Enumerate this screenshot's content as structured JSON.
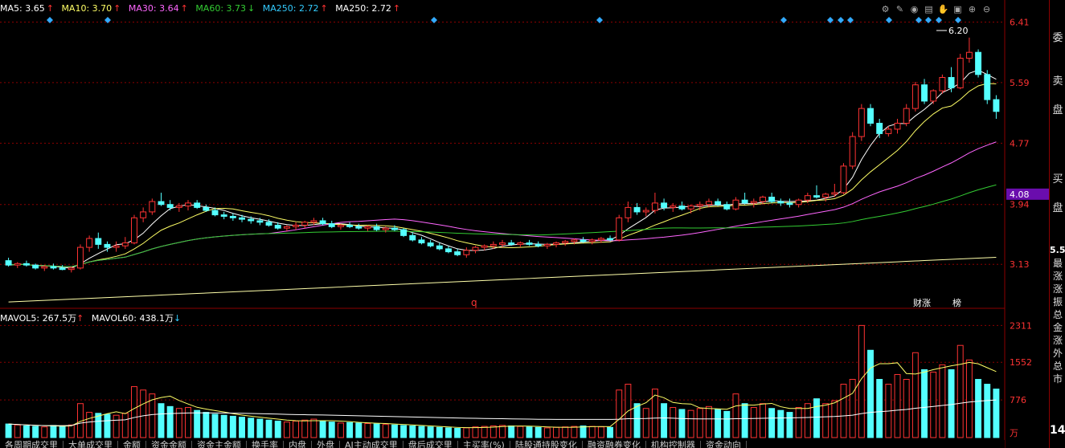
{
  "ma_legend": {
    "ma5": {
      "label": "MA5: 3.65",
      "color": "#ffffff"
    },
    "ma10": {
      "label": "MA10: 3.70",
      "color": "#ffff66"
    },
    "ma30": {
      "label": "MA30: 3.64",
      "color": "#ff66ff"
    },
    "ma60": {
      "label": "MA60: 3.73",
      "color": "#33cc33"
    },
    "ma250a": {
      "label": "MA250: 2.72",
      "color": "#33ccff"
    },
    "ma250b": {
      "label": "MA250: 2.72",
      "color": "#ffffff"
    },
    "up_arrow": "↑",
    "down_arrow": "↓"
  },
  "vol_legend": {
    "mavol5": "MAVOL5: 267.5万",
    "mavol60": "MAVOL60: 438.1万"
  },
  "price_axis": [
    "6.41",
    "5.59",
    "4.77",
    "3.94",
    "3.13"
  ],
  "current_price_tag": "4.08",
  "high_label": "6.20",
  "volume_axis": [
    "2311",
    "1552",
    "776"
  ],
  "volume_unit": "万",
  "markers": {
    "q_label": "q",
    "caizhang": "财涨",
    "bang": "榜"
  },
  "right_panel": {
    "wei": "委",
    "mai_sell": "卖",
    "pan1": "盘",
    "mai_buy": "买",
    "pan2": "盘",
    "num1": "5.5",
    "col_text": "最涨涨振总金涨外总市",
    "num2": "14"
  },
  "toolbar_icons": [
    "gear-icon",
    "pencil-icon",
    "eye-icon",
    "print-icon",
    "hand-icon",
    "lock-icon",
    "zoom-in-icon",
    "zoom-out-icon"
  ],
  "bottom_tabs": [
    "各周期成交里",
    "大单成交里",
    "金额",
    "资金金额",
    "资金主金额",
    "换手率",
    "内盘",
    "外盘",
    "AI主动成交里",
    "盘后成交里",
    "主买率(%)",
    "陆股通持股变化",
    "融资融券变化",
    "机构控制器",
    "资金动向"
  ],
  "chart_data": {
    "type": "candlestick",
    "ylim": [
      2.6,
      6.6
    ],
    "volume_ylim": [
      0,
      2400
    ],
    "candles": [
      [
        3.18,
        3.22,
        3.1,
        3.12
      ],
      [
        3.12,
        3.16,
        3.08,
        3.14
      ],
      [
        3.14,
        3.18,
        3.1,
        3.12
      ],
      [
        3.12,
        3.14,
        3.06,
        3.08
      ],
      [
        3.08,
        3.12,
        3.04,
        3.1
      ],
      [
        3.1,
        3.14,
        3.06,
        3.08
      ],
      [
        3.08,
        3.12,
        3.05,
        3.06
      ],
      [
        3.06,
        3.1,
        3.02,
        3.08
      ],
      [
        3.08,
        3.4,
        3.06,
        3.36
      ],
      [
        3.36,
        3.52,
        3.3,
        3.48
      ],
      [
        3.48,
        3.56,
        3.34,
        3.4
      ],
      [
        3.4,
        3.44,
        3.3,
        3.36
      ],
      [
        3.36,
        3.44,
        3.3,
        3.38
      ],
      [
        3.38,
        3.5,
        3.34,
        3.42
      ],
      [
        3.42,
        3.8,
        3.4,
        3.76
      ],
      [
        3.76,
        3.9,
        3.7,
        3.84
      ],
      [
        3.84,
        4.02,
        3.8,
        3.98
      ],
      [
        3.98,
        4.1,
        3.92,
        3.94
      ],
      [
        3.94,
        4.0,
        3.86,
        3.9
      ],
      [
        3.9,
        3.96,
        3.84,
        3.92
      ],
      [
        3.92,
        4.0,
        3.86,
        3.96
      ],
      [
        3.96,
        4.0,
        3.88,
        3.9
      ],
      [
        3.9,
        3.94,
        3.84,
        3.86
      ],
      [
        3.86,
        3.9,
        3.78,
        3.8
      ],
      [
        3.8,
        3.84,
        3.74,
        3.78
      ],
      [
        3.78,
        3.82,
        3.72,
        3.76
      ],
      [
        3.76,
        3.8,
        3.7,
        3.74
      ],
      [
        3.74,
        3.78,
        3.68,
        3.72
      ],
      [
        3.72,
        3.76,
        3.66,
        3.7
      ],
      [
        3.7,
        3.74,
        3.64,
        3.66
      ],
      [
        3.66,
        3.7,
        3.6,
        3.62
      ],
      [
        3.62,
        3.66,
        3.58,
        3.64
      ],
      [
        3.64,
        3.7,
        3.6,
        3.66
      ],
      [
        3.66,
        3.72,
        3.62,
        3.7
      ],
      [
        3.7,
        3.76,
        3.66,
        3.72
      ],
      [
        3.72,
        3.76,
        3.66,
        3.68
      ],
      [
        3.68,
        3.72,
        3.62,
        3.64
      ],
      [
        3.64,
        3.68,
        3.6,
        3.66
      ],
      [
        3.66,
        3.7,
        3.62,
        3.64
      ],
      [
        3.64,
        3.68,
        3.6,
        3.62
      ],
      [
        3.62,
        3.66,
        3.58,
        3.64
      ],
      [
        3.64,
        3.68,
        3.58,
        3.6
      ],
      [
        3.6,
        3.64,
        3.56,
        3.62
      ],
      [
        3.62,
        3.66,
        3.58,
        3.6
      ],
      [
        3.6,
        3.62,
        3.5,
        3.52
      ],
      [
        3.52,
        3.56,
        3.44,
        3.46
      ],
      [
        3.46,
        3.5,
        3.4,
        3.42
      ],
      [
        3.42,
        3.46,
        3.36,
        3.38
      ],
      [
        3.38,
        3.42,
        3.32,
        3.34
      ],
      [
        3.34,
        3.38,
        3.28,
        3.3
      ],
      [
        3.3,
        3.34,
        3.24,
        3.26
      ],
      [
        3.26,
        3.36,
        3.22,
        3.32
      ],
      [
        3.32,
        3.38,
        3.28,
        3.36
      ],
      [
        3.36,
        3.4,
        3.32,
        3.38
      ],
      [
        3.38,
        3.44,
        3.34,
        3.4
      ],
      [
        3.4,
        3.46,
        3.36,
        3.42
      ],
      [
        3.42,
        3.46,
        3.38,
        3.4
      ],
      [
        3.4,
        3.44,
        3.36,
        3.42
      ],
      [
        3.42,
        3.46,
        3.38,
        3.4
      ],
      [
        3.4,
        3.44,
        3.36,
        3.38
      ],
      [
        3.38,
        3.42,
        3.34,
        3.4
      ],
      [
        3.4,
        3.44,
        3.36,
        3.42
      ],
      [
        3.42,
        3.46,
        3.38,
        3.44
      ],
      [
        3.44,
        3.48,
        3.4,
        3.46
      ],
      [
        3.46,
        3.5,
        3.42,
        3.44
      ],
      [
        3.44,
        3.48,
        3.4,
        3.46
      ],
      [
        3.46,
        3.5,
        3.42,
        3.48
      ],
      [
        3.48,
        3.52,
        3.44,
        3.46
      ],
      [
        3.46,
        3.8,
        3.44,
        3.76
      ],
      [
        3.76,
        3.98,
        3.7,
        3.9
      ],
      [
        3.9,
        3.96,
        3.8,
        3.84
      ],
      [
        3.84,
        3.9,
        3.78,
        3.86
      ],
      [
        3.86,
        4.1,
        3.82,
        3.96
      ],
      [
        3.96,
        4.02,
        3.86,
        3.9
      ],
      [
        3.9,
        3.96,
        3.84,
        3.92
      ],
      [
        3.92,
        3.98,
        3.86,
        3.88
      ],
      [
        3.88,
        3.94,
        3.82,
        3.92
      ],
      [
        3.92,
        3.98,
        3.86,
        3.94
      ],
      [
        3.94,
        4.02,
        3.9,
        3.98
      ],
      [
        3.98,
        4.02,
        3.92,
        3.94
      ],
      [
        3.94,
        3.98,
        3.86,
        3.88
      ],
      [
        3.88,
        4.04,
        3.86,
        4.0
      ],
      [
        4.0,
        4.1,
        3.94,
        3.96
      ],
      [
        3.96,
        4.02,
        3.9,
        3.98
      ],
      [
        3.98,
        4.06,
        3.94,
        4.04
      ],
      [
        4.04,
        4.1,
        3.96,
        3.98
      ],
      [
        3.98,
        4.02,
        3.92,
        3.96
      ],
      [
        3.96,
        4.02,
        3.9,
        3.94
      ],
      [
        3.94,
        4.02,
        3.9,
        4.0
      ],
      [
        4.0,
        4.1,
        3.96,
        4.06
      ],
      [
        4.06,
        4.2,
        4.02,
        4.04
      ],
      [
        4.04,
        4.1,
        3.98,
        4.08
      ],
      [
        4.08,
        4.22,
        4.04,
        4.1
      ],
      [
        4.1,
        4.5,
        4.08,
        4.46
      ],
      [
        4.46,
        4.92,
        4.42,
        4.86
      ],
      [
        4.86,
        5.3,
        4.8,
        5.24
      ],
      [
        5.24,
        5.3,
        5.0,
        5.04
      ],
      [
        5.04,
        5.1,
        4.84,
        4.9
      ],
      [
        4.9,
        5.0,
        4.86,
        4.96
      ],
      [
        4.96,
        5.1,
        4.9,
        5.04
      ],
      [
        5.04,
        5.3,
        5.0,
        5.24
      ],
      [
        5.24,
        5.6,
        5.2,
        5.56
      ],
      [
        5.56,
        5.64,
        5.3,
        5.34
      ],
      [
        5.34,
        5.5,
        5.3,
        5.48
      ],
      [
        5.48,
        5.7,
        5.44,
        5.66
      ],
      [
        5.66,
        5.8,
        5.46,
        5.52
      ],
      [
        5.52,
        5.98,
        5.5,
        5.92
      ],
      [
        5.92,
        6.2,
        5.86,
        6.0
      ],
      [
        6.0,
        6.04,
        5.66,
        5.7
      ],
      [
        5.7,
        5.76,
        5.3,
        5.36
      ],
      [
        5.36,
        5.42,
        5.1,
        5.2
      ]
    ],
    "volumes": [
      280,
      260,
      240,
      230,
      220,
      250,
      240,
      260,
      700,
      520,
      500,
      480,
      460,
      500,
      1050,
      980,
      900,
      700,
      640,
      600,
      620,
      560,
      520,
      480,
      460,
      440,
      420,
      400,
      380,
      360,
      340,
      320,
      340,
      360,
      380,
      340,
      320,
      300,
      310,
      300,
      290,
      280,
      270,
      260,
      250,
      240,
      230,
      220,
      210,
      200,
      190,
      200,
      220,
      230,
      240,
      250,
      240,
      230,
      220,
      210,
      200,
      210,
      220,
      230,
      240,
      230,
      220,
      210,
      980,
      1100,
      700,
      600,
      1000,
      700,
      620,
      580,
      560,
      600,
      640,
      580,
      540,
      900,
      700,
      620,
      700,
      600,
      560,
      520,
      620,
      700,
      800,
      700,
      760,
      1100,
      1200,
      2311,
      1800,
      1200,
      1100,
      1300,
      1200,
      1750,
      1400,
      1350,
      1500,
      1400,
      1900,
      1600,
      1200,
      1100,
      1000
    ],
    "ma_lines": {
      "ma5_color": "#ffffff",
      "ma10_color": "#ffff66",
      "ma30_color": "#ff66ff",
      "ma60_color": "#33cc33",
      "ma250_color": "#ffffaa"
    }
  }
}
